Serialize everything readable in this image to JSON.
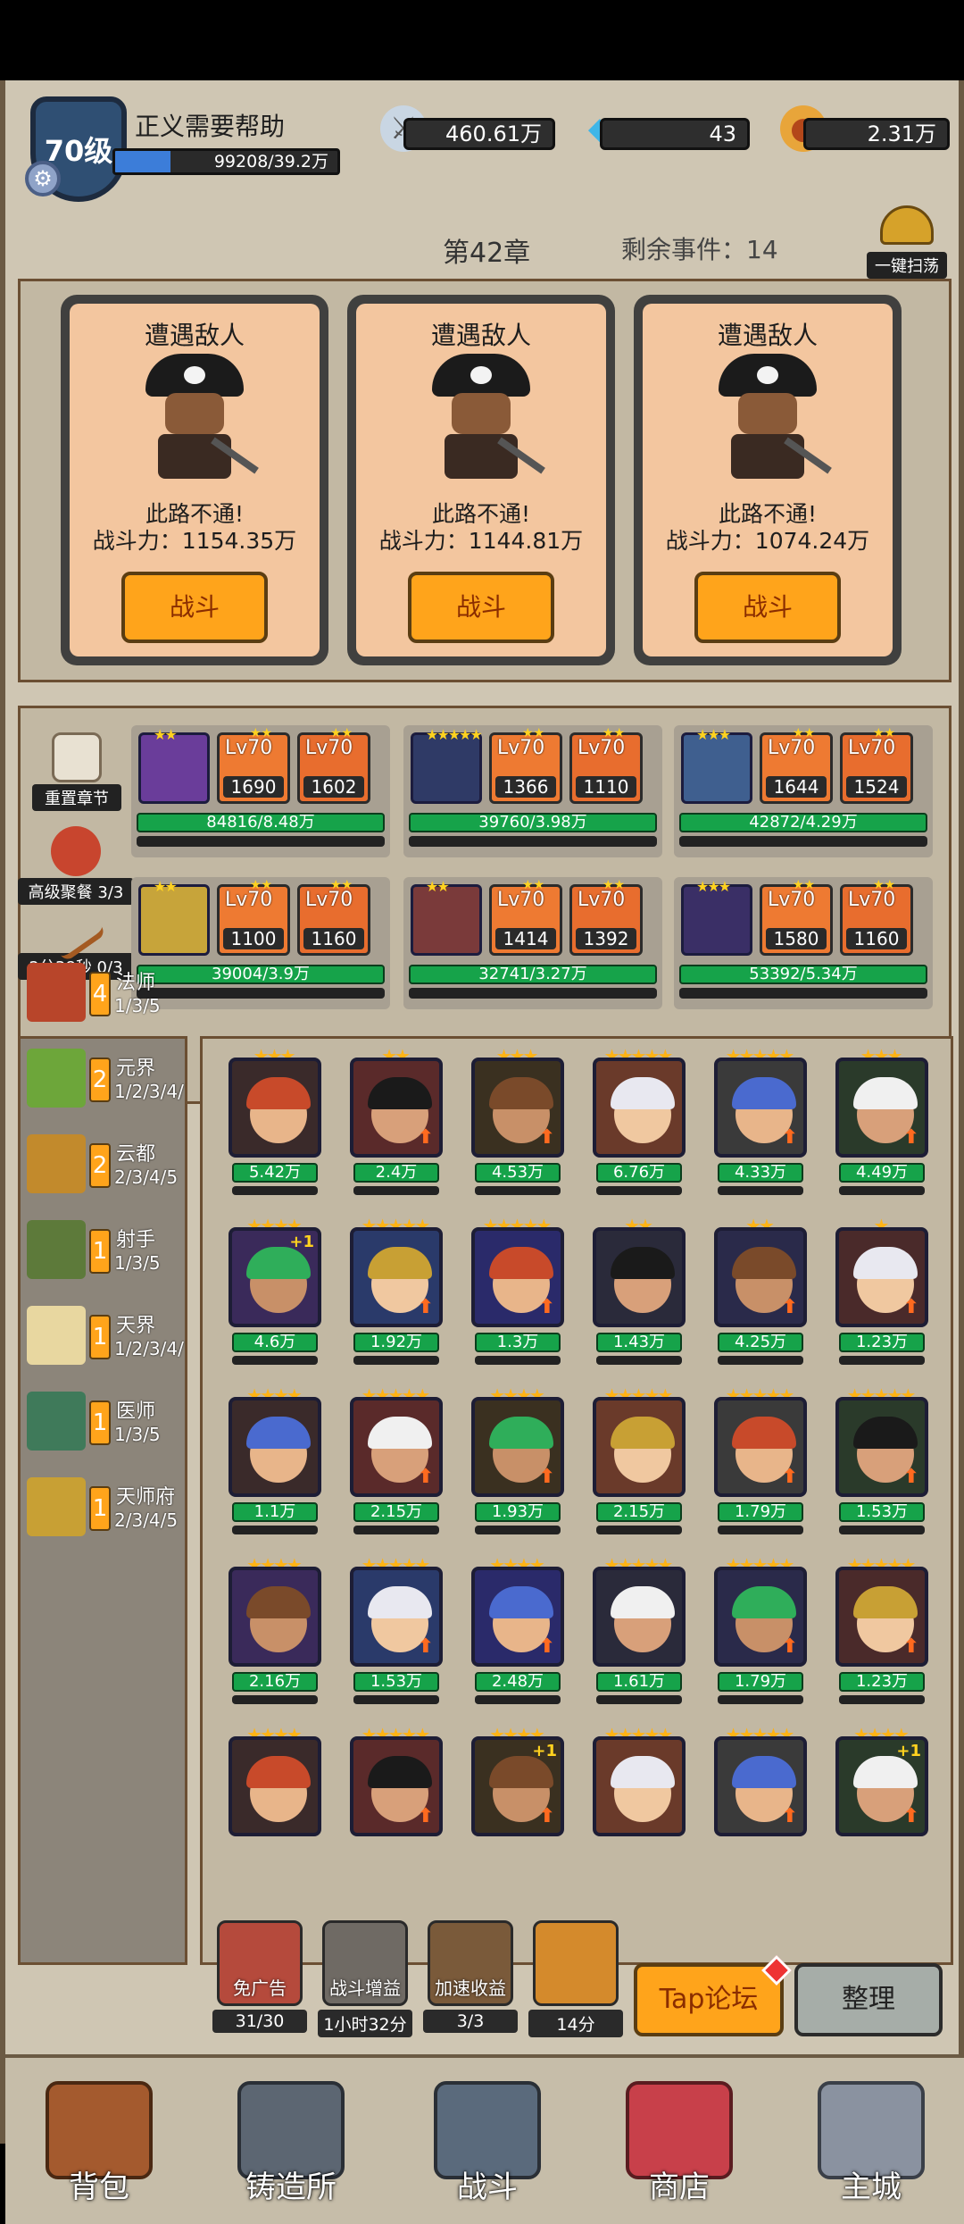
{
  "player": {
    "level": "70级",
    "name": "正义需要帮助",
    "xp_text": "99208/39.2万",
    "xp_fraction": 0.25
  },
  "resources": {
    "power": "460.61万",
    "gems": "43",
    "gold": "2.31万"
  },
  "chapter": {
    "title": "第42章",
    "remaining": "剩余事件：14",
    "sweep_label": "一键扫荡"
  },
  "encounters": [
    {
      "title": "遭遇敌人",
      "subtitle": "此路不通!",
      "power": "战斗力：1154.35万",
      "button": "战斗"
    },
    {
      "title": "遭遇敌人",
      "subtitle": "此路不通!",
      "power": "战斗力：1144.81万",
      "button": "战斗"
    },
    {
      "title": "遭遇敌人",
      "subtitle": "此路不通!",
      "power": "战斗力：1074.24万",
      "button": "战斗"
    }
  ],
  "side_actions": {
    "reset": "重置章节",
    "feast": "高级聚餐 3/3",
    "timer": "2分38秒 0/3"
  },
  "teams": [
    {
      "w1_lv": "Lv70",
      "w1_val": "1690",
      "w2_lv": "Lv70",
      "w2_val": "1602",
      "hp": "84816/8.48万"
    },
    {
      "w1_lv": "Lv70",
      "w1_val": "1366",
      "w2_lv": "Lv70",
      "w2_val": "1110",
      "hp": "39760/3.98万"
    },
    {
      "w1_lv": "Lv70",
      "w1_val": "1644",
      "w2_lv": "Lv70",
      "w2_val": "1524",
      "hp": "42872/4.29万"
    },
    {
      "w1_lv": "Lv70",
      "w1_val": "1100",
      "w2_lv": "Lv70",
      "w2_val": "1160",
      "hp": "39004/3.9万"
    },
    {
      "w1_lv": "Lv70",
      "w1_val": "1414",
      "w2_lv": "Lv70",
      "w2_val": "1392",
      "hp": "32741/3.27万"
    },
    {
      "w1_lv": "Lv70",
      "w1_val": "1580",
      "w2_lv": "Lv70",
      "w2_val": "1160",
      "hp": "53392/5.34万"
    }
  ],
  "classes": [
    {
      "count": "4",
      "name": "法师",
      "progress": "1/3/5"
    },
    {
      "count": "2",
      "name": "元界",
      "progress": "1/2/3/4/"
    },
    {
      "count": "2",
      "name": "云都",
      "progress": "2/3/4/5"
    },
    {
      "count": "1",
      "name": "射手",
      "progress": "1/3/5"
    },
    {
      "count": "1",
      "name": "天界",
      "progress": "1/2/3/4/"
    },
    {
      "count": "1",
      "name": "医师",
      "progress": "1/3/5"
    },
    {
      "count": "1",
      "name": "天师府",
      "progress": "2/3/4/5"
    }
  ],
  "heroes": [
    {
      "stars": "★★★",
      "power": "5.42万"
    },
    {
      "stars": "★★",
      "power": "2.4万"
    },
    {
      "stars": "★★★",
      "power": "4.53万"
    },
    {
      "stars": "★★★★★",
      "power": "6.76万"
    },
    {
      "stars": "★★★★★",
      "power": "4.33万"
    },
    {
      "stars": "★★★",
      "power": "4.49万"
    },
    {
      "stars": "★★★★",
      "power": "4.6万"
    },
    {
      "stars": "★★★★★",
      "power": "1.92万"
    },
    {
      "stars": "★★★★★",
      "power": "1.3万"
    },
    {
      "stars": "★★",
      "power": "1.43万"
    },
    {
      "stars": "★★",
      "power": "4.25万"
    },
    {
      "stars": "★",
      "power": "1.23万"
    },
    {
      "stars": "★★★★",
      "power": "1.1万"
    },
    {
      "stars": "★★★★★",
      "power": "2.15万"
    },
    {
      "stars": "★★★★",
      "power": "1.93万"
    },
    {
      "stars": "★★★★★",
      "power": "2.15万"
    },
    {
      "stars": "★★★★★",
      "power": "1.79万"
    },
    {
      "stars": "★★★★★",
      "power": "1.53万"
    },
    {
      "stars": "★★★★",
      "power": "2.16万"
    },
    {
      "stars": "★★★★★",
      "power": "1.53万"
    },
    {
      "stars": "★★★★",
      "power": "2.48万"
    },
    {
      "stars": "★★★★★",
      "power": "1.61万"
    },
    {
      "stars": "★★★★★",
      "power": "1.79万"
    },
    {
      "stars": "★★★★★",
      "power": "1.23万"
    },
    {
      "stars": "★★★★",
      "power": ""
    },
    {
      "stars": "★★★★★",
      "power": ""
    },
    {
      "stars": "★★★★",
      "power": ""
    },
    {
      "stars": "★★★★★",
      "power": ""
    },
    {
      "stars": "★★★★★",
      "power": ""
    },
    {
      "stars": "★★★★",
      "power": ""
    }
  ],
  "utilities": [
    {
      "label": "免广告",
      "count": "31/30"
    },
    {
      "label": "战斗增益",
      "count": "1小时32分"
    },
    {
      "label": "加速收益",
      "count": "3/3"
    },
    {
      "label": "",
      "count": "14分"
    }
  ],
  "forum_button": "Tap论坛",
  "arrange_button": "整理",
  "nav": {
    "bag": "背包",
    "forge": "铸造所",
    "battle": "战斗",
    "shop": "商店",
    "city": "主城"
  }
}
